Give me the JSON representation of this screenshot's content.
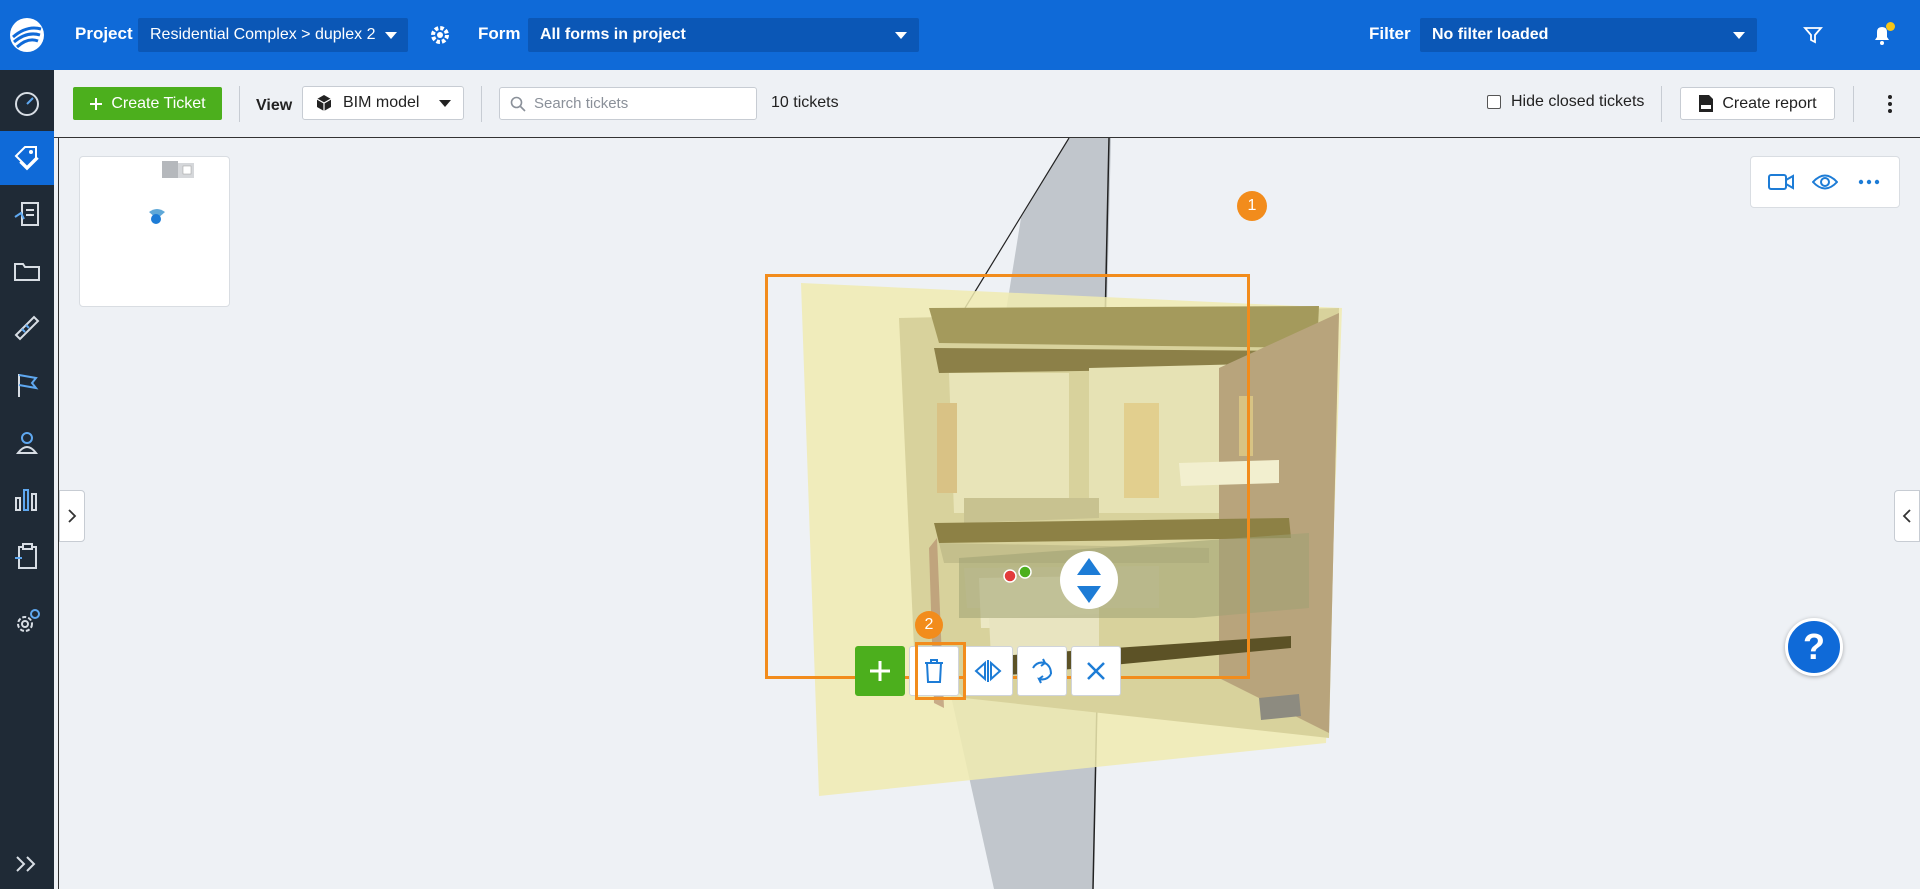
{
  "header": {
    "project_label": "Project",
    "project_value": "Residential Complex > duplex 2",
    "form_label": "Form",
    "form_value": "All forms in project",
    "filter_label": "Filter",
    "filter_value": "No filter loaded"
  },
  "toolbar": {
    "create_ticket_label": "Create Ticket",
    "view_label": "View",
    "view_value": "BIM model",
    "search_placeholder": "Search tickets",
    "ticket_count": "10 tickets",
    "hide_closed_label": "Hide closed tickets",
    "create_report_label": "Create report"
  },
  "sidebar": {
    "items": [
      {
        "name": "dashboard-icon"
      },
      {
        "name": "tickets-icon",
        "active": true
      },
      {
        "name": "forms-icon"
      },
      {
        "name": "folder-icon"
      },
      {
        "name": "measure-icon"
      },
      {
        "name": "milestone-flag-icon"
      },
      {
        "name": "contacts-icon"
      },
      {
        "name": "reports-icon"
      },
      {
        "name": "checklist-icon"
      },
      {
        "name": "settings-icon"
      }
    ]
  },
  "viewer": {
    "callouts": [
      "1",
      "2"
    ]
  },
  "help": {
    "label": "?"
  },
  "colors": {
    "brand_blue": "#0f6ad8",
    "sidebar_dark": "#1f2a36",
    "create_green": "#4caf1d",
    "callout_orange": "#f28c1c"
  }
}
